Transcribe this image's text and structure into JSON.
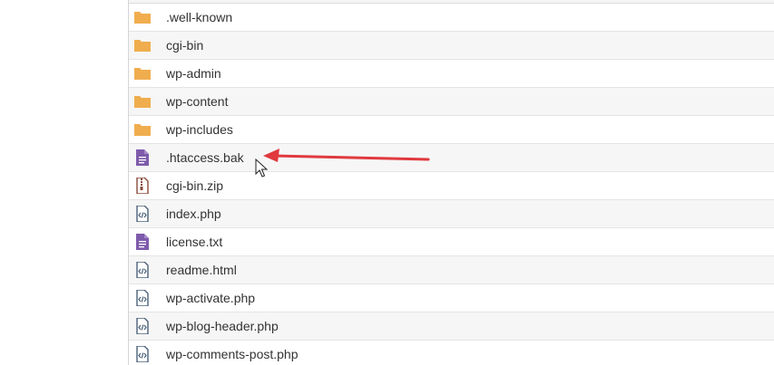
{
  "files": [
    {
      "name": ".well-known",
      "type": "folder",
      "icon": "folder-icon"
    },
    {
      "name": "cgi-bin",
      "type": "folder",
      "icon": "folder-icon"
    },
    {
      "name": "wp-admin",
      "type": "folder",
      "icon": "folder-icon"
    },
    {
      "name": "wp-content",
      "type": "folder",
      "icon": "folder-icon"
    },
    {
      "name": "wp-includes",
      "type": "folder",
      "icon": "folder-icon"
    },
    {
      "name": ".htaccess.bak",
      "type": "text",
      "icon": "text-file-icon"
    },
    {
      "name": "cgi-bin.zip",
      "type": "zip",
      "icon": "zip-file-icon"
    },
    {
      "name": "index.php",
      "type": "code",
      "icon": "code-file-icon"
    },
    {
      "name": "license.txt",
      "type": "text",
      "icon": "text-file-icon"
    },
    {
      "name": "readme.html",
      "type": "code",
      "icon": "code-file-icon"
    },
    {
      "name": "wp-activate.php",
      "type": "code",
      "icon": "code-file-icon"
    },
    {
      "name": "wp-blog-header.php",
      "type": "code",
      "icon": "code-file-icon"
    },
    {
      "name": "wp-comments-post.php",
      "type": "code",
      "icon": "code-file-icon"
    }
  ],
  "colors": {
    "folder": "#f0ad4e",
    "text_file": "#7e5bab",
    "zip_file": "#8a4a3a",
    "code_file": "#4a6079",
    "arrow": "#e0393e"
  },
  "annotation": {
    "icon": "red-arrow-icon",
    "cursor_icon": "mouse-pointer-icon"
  }
}
